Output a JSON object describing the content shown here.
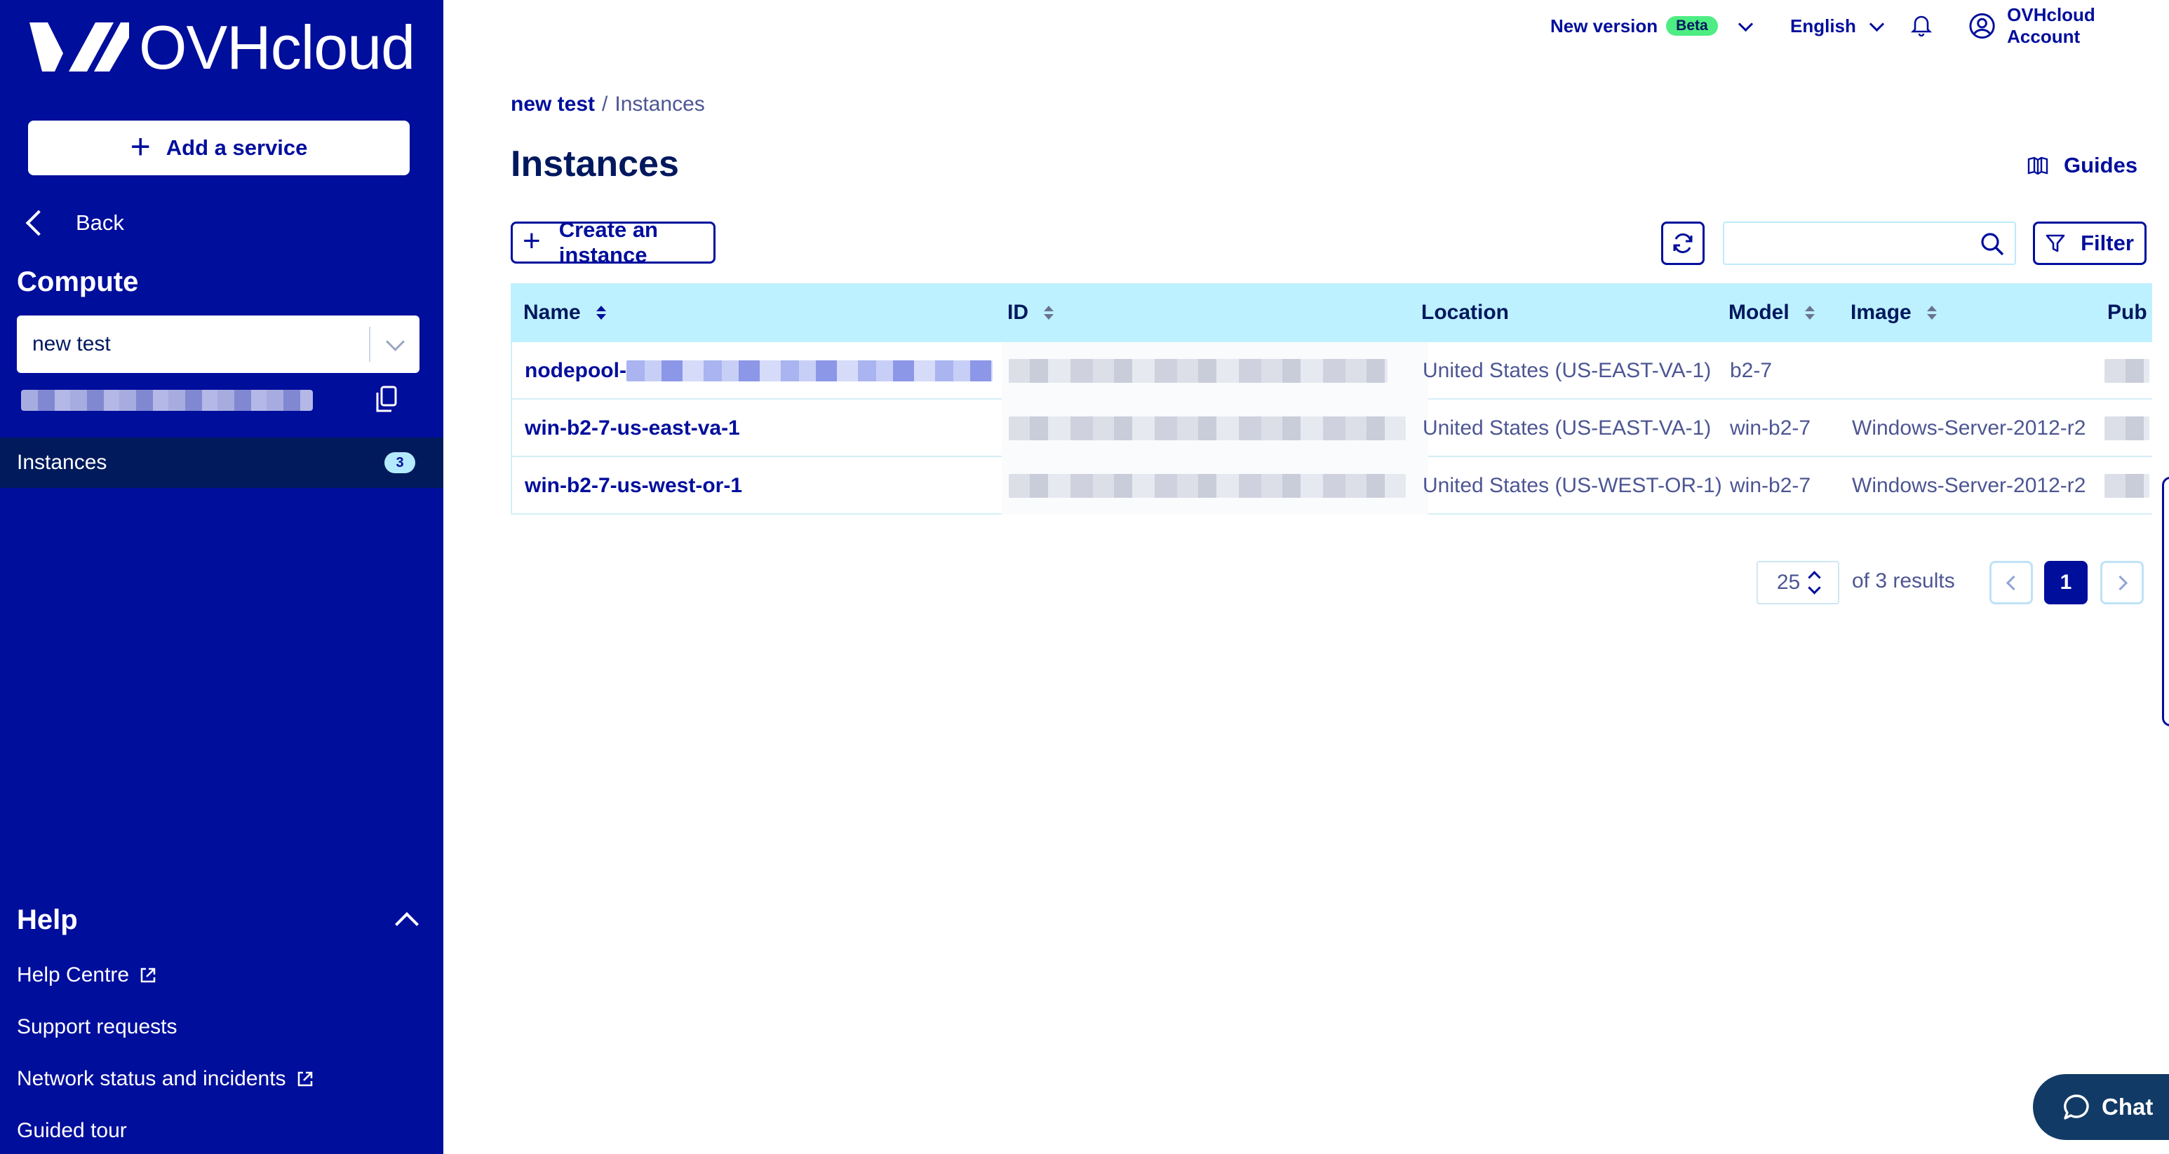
{
  "brand": {
    "name": "OVHcloud"
  },
  "sidebar": {
    "add_service_label": "Add a service",
    "back_label": "Back",
    "section_title": "Compute",
    "project_select_value": "new test",
    "nav": [
      {
        "label": "Instances",
        "badge": "3"
      }
    ],
    "help": {
      "title": "Help",
      "links": [
        {
          "label": "Help Centre",
          "external": true
        },
        {
          "label": "Support requests",
          "external": false
        },
        {
          "label": "Network status and incidents",
          "external": true
        },
        {
          "label": "Guided tour",
          "external": false
        }
      ]
    }
  },
  "topbar": {
    "new_version_label": "New version",
    "beta_badge": "Beta",
    "language": "English",
    "account_label": "OVHcloud Account"
  },
  "breadcrumb": {
    "project": "new test",
    "separator": "/",
    "current": "Instances"
  },
  "page": {
    "title": "Instances",
    "guides_label": "Guides",
    "create_label": "Create an instance",
    "filter_label": "Filter",
    "search_placeholder": ""
  },
  "table": {
    "columns": [
      "Name",
      "ID",
      "Location",
      "Model",
      "Image",
      "Pub"
    ],
    "rows": [
      {
        "name": "nodepool-",
        "location": "United States (US-EAST-VA-1)",
        "model": "b2-7",
        "image": ""
      },
      {
        "name": "win-b2-7-us-east-va-1",
        "location": "United States (US-EAST-VA-1)",
        "model": "win-b2-7",
        "image": "Windows-Server-2012-r2"
      },
      {
        "name": "win-b2-7-us-west-or-1",
        "location": "United States (US-WEST-OR-1)",
        "model": "win-b2-7",
        "image": "Windows-Server-2012-r2"
      }
    ]
  },
  "pagination": {
    "per_page": "25",
    "results_text": "of 3 results",
    "current_page": "1"
  },
  "chat": {
    "label": "Chat"
  },
  "colors": {
    "sidebar": "#000e9c",
    "accent": "#000e9c",
    "table_header": "#bef1ff",
    "beta": "#4ded83",
    "chat": "#123a66"
  }
}
